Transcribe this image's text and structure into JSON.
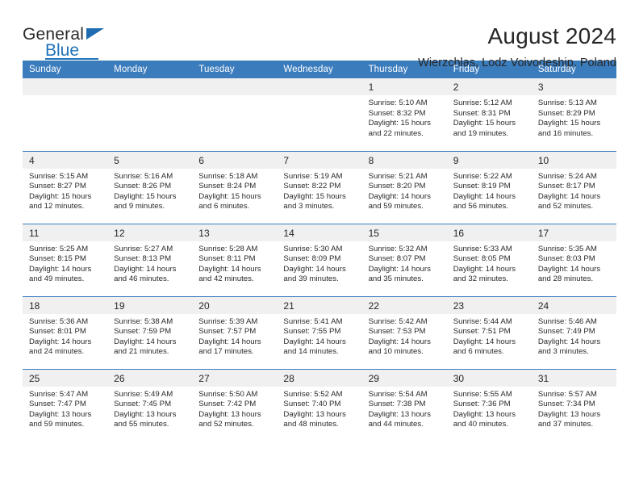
{
  "brand": {
    "name_top": "General",
    "name_bottom": "Blue",
    "accent_color": "#1f72b8"
  },
  "header": {
    "title": "August 2024",
    "subtitle": "Wierzchlas, Lodz Voivodeship, Poland"
  },
  "theme": {
    "header_bg": "#3b7cbd",
    "daynum_bg": "#f0f0f0",
    "text": "#262626"
  },
  "calendar": {
    "weekday_headers": [
      "Sunday",
      "Monday",
      "Tuesday",
      "Wednesday",
      "Thursday",
      "Friday",
      "Saturday"
    ],
    "weeks": [
      [
        {
          "day": "",
          "lines": [
            "",
            "",
            "",
            ""
          ]
        },
        {
          "day": "",
          "lines": [
            "",
            "",
            "",
            ""
          ]
        },
        {
          "day": "",
          "lines": [
            "",
            "",
            "",
            ""
          ]
        },
        {
          "day": "",
          "lines": [
            "",
            "",
            "",
            ""
          ]
        },
        {
          "day": "1",
          "lines": [
            "Sunrise: 5:10 AM",
            "Sunset: 8:32 PM",
            "Daylight: 15 hours",
            "and 22 minutes."
          ]
        },
        {
          "day": "2",
          "lines": [
            "Sunrise: 5:12 AM",
            "Sunset: 8:31 PM",
            "Daylight: 15 hours",
            "and 19 minutes."
          ]
        },
        {
          "day": "3",
          "lines": [
            "Sunrise: 5:13 AM",
            "Sunset: 8:29 PM",
            "Daylight: 15 hours",
            "and 16 minutes."
          ]
        }
      ],
      [
        {
          "day": "4",
          "lines": [
            "Sunrise: 5:15 AM",
            "Sunset: 8:27 PM",
            "Daylight: 15 hours",
            "and 12 minutes."
          ]
        },
        {
          "day": "5",
          "lines": [
            "Sunrise: 5:16 AM",
            "Sunset: 8:26 PM",
            "Daylight: 15 hours",
            "and 9 minutes."
          ]
        },
        {
          "day": "6",
          "lines": [
            "Sunrise: 5:18 AM",
            "Sunset: 8:24 PM",
            "Daylight: 15 hours",
            "and 6 minutes."
          ]
        },
        {
          "day": "7",
          "lines": [
            "Sunrise: 5:19 AM",
            "Sunset: 8:22 PM",
            "Daylight: 15 hours",
            "and 3 minutes."
          ]
        },
        {
          "day": "8",
          "lines": [
            "Sunrise: 5:21 AM",
            "Sunset: 8:20 PM",
            "Daylight: 14 hours",
            "and 59 minutes."
          ]
        },
        {
          "day": "9",
          "lines": [
            "Sunrise: 5:22 AM",
            "Sunset: 8:19 PM",
            "Daylight: 14 hours",
            "and 56 minutes."
          ]
        },
        {
          "day": "10",
          "lines": [
            "Sunrise: 5:24 AM",
            "Sunset: 8:17 PM",
            "Daylight: 14 hours",
            "and 52 minutes."
          ]
        }
      ],
      [
        {
          "day": "11",
          "lines": [
            "Sunrise: 5:25 AM",
            "Sunset: 8:15 PM",
            "Daylight: 14 hours",
            "and 49 minutes."
          ]
        },
        {
          "day": "12",
          "lines": [
            "Sunrise: 5:27 AM",
            "Sunset: 8:13 PM",
            "Daylight: 14 hours",
            "and 46 minutes."
          ]
        },
        {
          "day": "13",
          "lines": [
            "Sunrise: 5:28 AM",
            "Sunset: 8:11 PM",
            "Daylight: 14 hours",
            "and 42 minutes."
          ]
        },
        {
          "day": "14",
          "lines": [
            "Sunrise: 5:30 AM",
            "Sunset: 8:09 PM",
            "Daylight: 14 hours",
            "and 39 minutes."
          ]
        },
        {
          "day": "15",
          "lines": [
            "Sunrise: 5:32 AM",
            "Sunset: 8:07 PM",
            "Daylight: 14 hours",
            "and 35 minutes."
          ]
        },
        {
          "day": "16",
          "lines": [
            "Sunrise: 5:33 AM",
            "Sunset: 8:05 PM",
            "Daylight: 14 hours",
            "and 32 minutes."
          ]
        },
        {
          "day": "17",
          "lines": [
            "Sunrise: 5:35 AM",
            "Sunset: 8:03 PM",
            "Daylight: 14 hours",
            "and 28 minutes."
          ]
        }
      ],
      [
        {
          "day": "18",
          "lines": [
            "Sunrise: 5:36 AM",
            "Sunset: 8:01 PM",
            "Daylight: 14 hours",
            "and 24 minutes."
          ]
        },
        {
          "day": "19",
          "lines": [
            "Sunrise: 5:38 AM",
            "Sunset: 7:59 PM",
            "Daylight: 14 hours",
            "and 21 minutes."
          ]
        },
        {
          "day": "20",
          "lines": [
            "Sunrise: 5:39 AM",
            "Sunset: 7:57 PM",
            "Daylight: 14 hours",
            "and 17 minutes."
          ]
        },
        {
          "day": "21",
          "lines": [
            "Sunrise: 5:41 AM",
            "Sunset: 7:55 PM",
            "Daylight: 14 hours",
            "and 14 minutes."
          ]
        },
        {
          "day": "22",
          "lines": [
            "Sunrise: 5:42 AM",
            "Sunset: 7:53 PM",
            "Daylight: 14 hours",
            "and 10 minutes."
          ]
        },
        {
          "day": "23",
          "lines": [
            "Sunrise: 5:44 AM",
            "Sunset: 7:51 PM",
            "Daylight: 14 hours",
            "and 6 minutes."
          ]
        },
        {
          "day": "24",
          "lines": [
            "Sunrise: 5:46 AM",
            "Sunset: 7:49 PM",
            "Daylight: 14 hours",
            "and 3 minutes."
          ]
        }
      ],
      [
        {
          "day": "25",
          "lines": [
            "Sunrise: 5:47 AM",
            "Sunset: 7:47 PM",
            "Daylight: 13 hours",
            "and 59 minutes."
          ]
        },
        {
          "day": "26",
          "lines": [
            "Sunrise: 5:49 AM",
            "Sunset: 7:45 PM",
            "Daylight: 13 hours",
            "and 55 minutes."
          ]
        },
        {
          "day": "27",
          "lines": [
            "Sunrise: 5:50 AM",
            "Sunset: 7:42 PM",
            "Daylight: 13 hours",
            "and 52 minutes."
          ]
        },
        {
          "day": "28",
          "lines": [
            "Sunrise: 5:52 AM",
            "Sunset: 7:40 PM",
            "Daylight: 13 hours",
            "and 48 minutes."
          ]
        },
        {
          "day": "29",
          "lines": [
            "Sunrise: 5:54 AM",
            "Sunset: 7:38 PM",
            "Daylight: 13 hours",
            "and 44 minutes."
          ]
        },
        {
          "day": "30",
          "lines": [
            "Sunrise: 5:55 AM",
            "Sunset: 7:36 PM",
            "Daylight: 13 hours",
            "and 40 minutes."
          ]
        },
        {
          "day": "31",
          "lines": [
            "Sunrise: 5:57 AM",
            "Sunset: 7:34 PM",
            "Daylight: 13 hours",
            "and 37 minutes."
          ]
        }
      ]
    ]
  }
}
